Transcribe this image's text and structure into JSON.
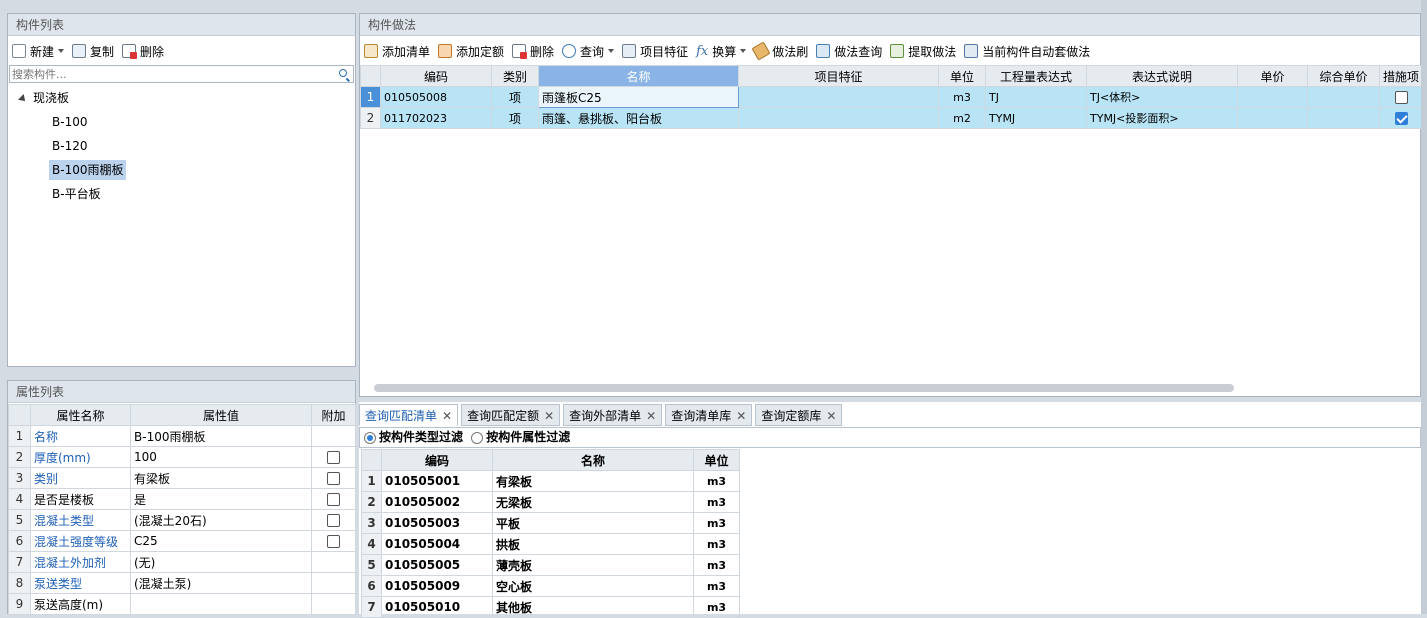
{
  "component_list": {
    "title": "构件列表",
    "toolbar": {
      "new": "新建",
      "copy": "复制",
      "delete": "删除"
    },
    "search_placeholder": "搜索构件...",
    "tree": {
      "root": "现浇板",
      "items": [
        "B-100",
        "B-120",
        "B-100雨棚板",
        "B-平台板"
      ],
      "selected_index": 2
    }
  },
  "property_list": {
    "title": "属性列表",
    "headers": {
      "name": "属性名称",
      "value": "属性值",
      "extra": "附加"
    },
    "rows": [
      {
        "no": "1",
        "name": "名称",
        "value": "B-100雨棚板",
        "blue": true,
        "checkbox": false
      },
      {
        "no": "2",
        "name": "厚度(mm)",
        "value": "100",
        "blue": true,
        "checkbox": true
      },
      {
        "no": "3",
        "name": "类别",
        "value": "有梁板",
        "blue": true,
        "checkbox": true
      },
      {
        "no": "4",
        "name": "是否是楼板",
        "value": "是",
        "blue": false,
        "checkbox": true
      },
      {
        "no": "5",
        "name": "混凝土类型",
        "value": "(混凝土20石)",
        "blue": true,
        "checkbox": true
      },
      {
        "no": "6",
        "name": "混凝土强度等级",
        "value": "C25",
        "blue": true,
        "checkbox": true
      },
      {
        "no": "7",
        "name": "混凝土外加剂",
        "value": "(无)",
        "blue": true,
        "checkbox": false
      },
      {
        "no": "8",
        "name": "泵送类型",
        "value": "(混凝土泵)",
        "blue": true,
        "checkbox": false
      },
      {
        "no": "9",
        "name": "泵送高度(m)",
        "value": "",
        "blue": false,
        "checkbox": false
      }
    ]
  },
  "method_panel": {
    "title": "构件做法",
    "toolbar": {
      "add_list": "添加清单",
      "add_quota": "添加定额",
      "delete": "删除",
      "query": "查询",
      "item_feature": "项目特征",
      "convert": "换算",
      "brush": "做法刷",
      "method_query": "做法查询",
      "extract": "提取做法",
      "auto_apply": "当前构件自动套做法"
    },
    "headers": {
      "code": "编码",
      "type": "类别",
      "name": "名称",
      "feature": "项目特征",
      "unit": "单位",
      "expr": "工程量表达式",
      "desc": "表达式说明",
      "price": "单价",
      "total_price": "综合单价",
      "measure": "措施项"
    },
    "rows": [
      {
        "no": "1",
        "code": "010505008",
        "type": "项",
        "name": "雨篷板C25",
        "feature": "",
        "unit": "m3",
        "expr": "TJ",
        "desc": "TJ<体积>",
        "price": "",
        "total_price": "",
        "checked": false
      },
      {
        "no": "2",
        "code": "011702023",
        "type": "项",
        "name": "雨篷、悬挑板、阳台板",
        "feature": "",
        "unit": "m2",
        "expr": "TYMJ",
        "desc": "TYMJ<投影面积>",
        "price": "",
        "total_price": "",
        "checked": true
      }
    ]
  },
  "query_panel": {
    "tabs": [
      {
        "label": "查询匹配清单",
        "active": true
      },
      {
        "label": "查询匹配定额",
        "active": false
      },
      {
        "label": "查询外部清单",
        "active": false
      },
      {
        "label": "查询清单库",
        "active": false
      },
      {
        "label": "查询定额库",
        "active": false
      }
    ],
    "close_glyph": "✕",
    "filters": {
      "by_type": "按构件类型过滤",
      "by_attr": "按构件属性过滤"
    },
    "headers": {
      "code": "编码",
      "name": "名称",
      "unit": "单位"
    },
    "rows": [
      {
        "no": "1",
        "code": "010505001",
        "name": "有梁板",
        "unit": "m3"
      },
      {
        "no": "2",
        "code": "010505002",
        "name": "无梁板",
        "unit": "m3"
      },
      {
        "no": "3",
        "code": "010505003",
        "name": "平板",
        "unit": "m3"
      },
      {
        "no": "4",
        "code": "010505004",
        "name": "拱板",
        "unit": "m3"
      },
      {
        "no": "5",
        "code": "010505005",
        "name": "薄壳板",
        "unit": "m3"
      },
      {
        "no": "6",
        "code": "010505009",
        "name": "空心板",
        "unit": "m3"
      },
      {
        "no": "7",
        "code": "010505010",
        "name": "其他板",
        "unit": "m3"
      }
    ]
  }
}
